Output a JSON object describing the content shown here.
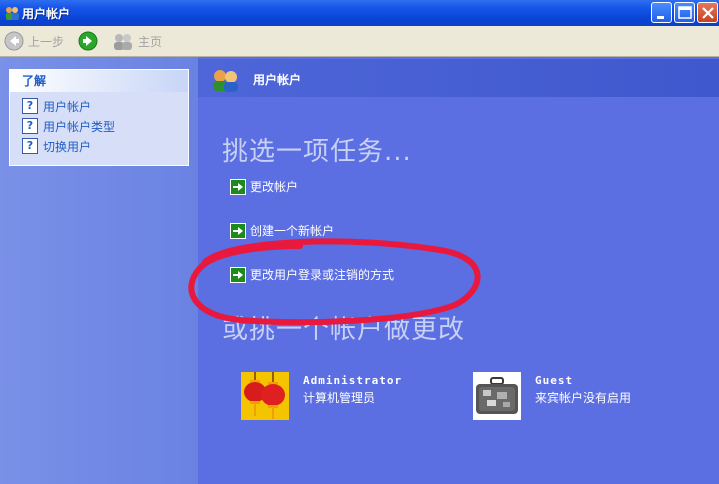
{
  "window": {
    "title": "用户帐户",
    "controls": [
      "minimize",
      "maximize",
      "close"
    ]
  },
  "toolbar": {
    "back_label": "上一步",
    "home_label": "主页",
    "icons": [
      "back-arrow-icon",
      "forward-arrow-icon",
      "users-home-icon"
    ]
  },
  "sidebar": {
    "learn_title": "了解",
    "items": [
      {
        "label": "用户帐户",
        "icon": "help-icon"
      },
      {
        "label": "用户帐户类型",
        "icon": "help-icon"
      },
      {
        "label": "切换用户",
        "icon": "help-icon"
      }
    ]
  },
  "main": {
    "header_title": "用户帐户",
    "pick_task_heading": "挑选一项任务...",
    "tasks": [
      {
        "label": "更改帐户"
      },
      {
        "label": "创建一个新帐户"
      },
      {
        "label": "更改用户登录或注销的方式"
      }
    ],
    "or_heading": "或挑一个帐户做更改",
    "accounts": [
      {
        "name": "Administrator",
        "role": "计算机管理员",
        "icon": "red-lanterns-picture"
      },
      {
        "name": "Guest",
        "role": "来宾帐户没有启用",
        "icon": "suitcase-picture"
      }
    ]
  },
  "colors": {
    "titlebar": "#0a45d8",
    "main_bg": "#5b6ee2",
    "link_blue": "#215dc6",
    "annotation_red": "#e8193c"
  }
}
